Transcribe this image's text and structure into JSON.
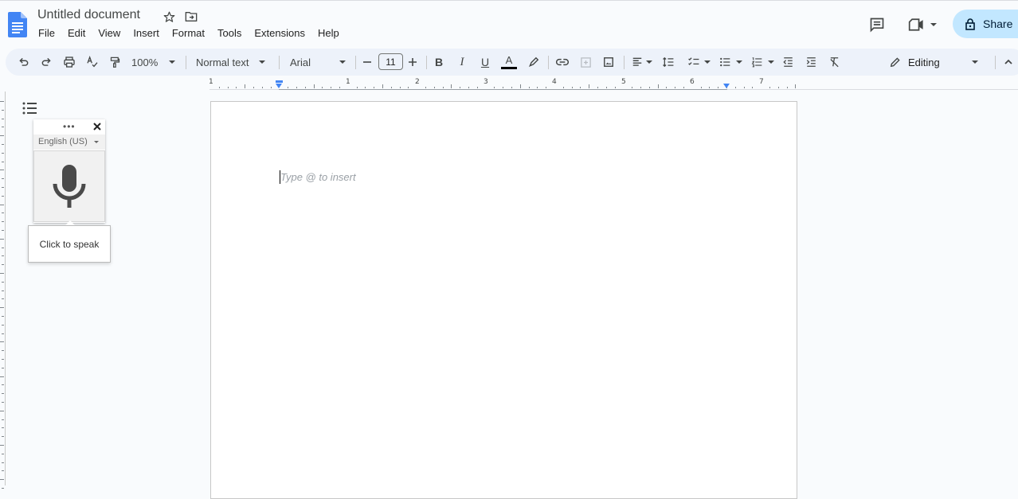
{
  "app": {
    "title": "Untitled document"
  },
  "menu": [
    "File",
    "Edit",
    "View",
    "Insert",
    "Format",
    "Tools",
    "Extensions",
    "Help"
  ],
  "header": {
    "share_label": "Share"
  },
  "toolbar": {
    "zoom": "100%",
    "style": "Normal text",
    "font": "Arial",
    "font_size": "11",
    "mode": "Editing",
    "text_color": "#000000"
  },
  "ruler": {
    "labels": [
      "1",
      "1",
      "2",
      "3",
      "4",
      "5",
      "6",
      "7"
    ]
  },
  "voice": {
    "dots": "•••",
    "language": "English (US)",
    "tooltip": "Click to speak"
  },
  "document": {
    "placeholder": "Type @ to insert"
  },
  "colors": {
    "accent": "#0b57d0",
    "share_bg": "#c2e7ff",
    "toolbar_bg": "#edf2fa",
    "docs_blue": "#4285f4"
  }
}
